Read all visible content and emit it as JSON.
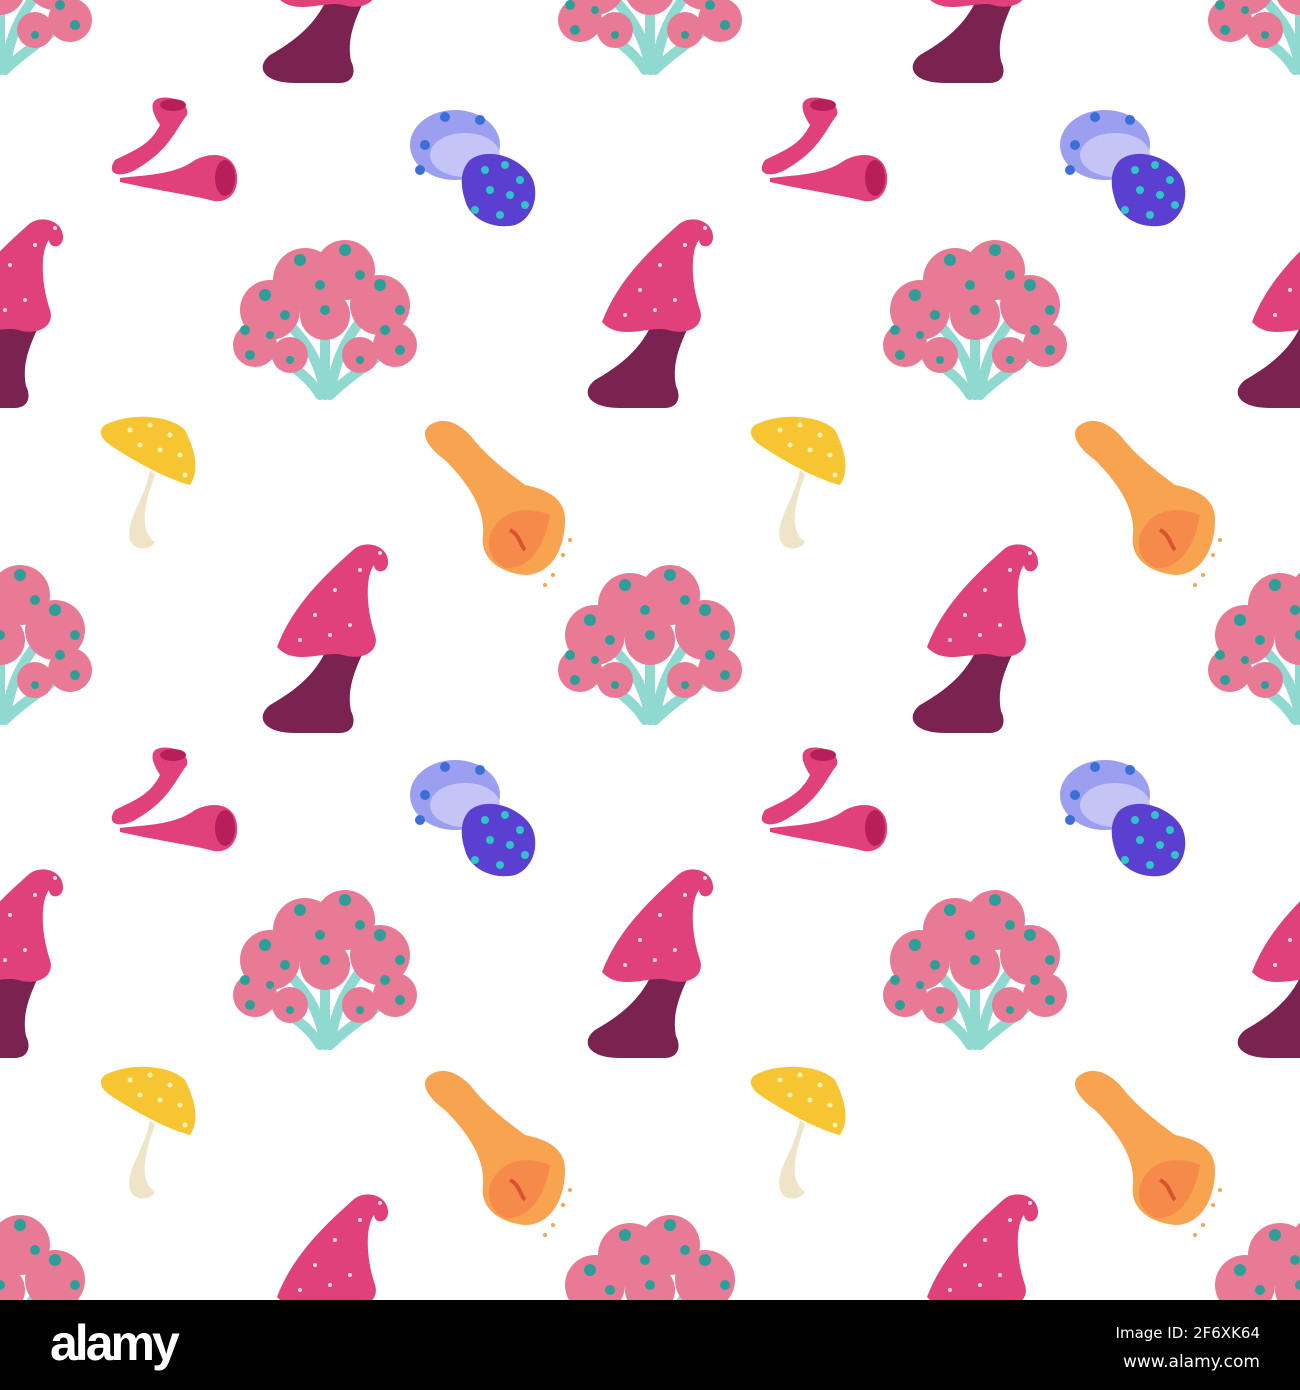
{
  "footer": {
    "brand": "alamy",
    "image_id": "Image ID: 2F6XK64",
    "url": "www.alamy.com"
  },
  "colors": {
    "background": "#ffffff",
    "footer": "#000000",
    "pink": "#e0417a",
    "plum": "#7a2350",
    "cluster_cap": "#e87a96",
    "teal": "#2e9e98",
    "blue": "#5a3fd0",
    "lavender": "#9c9ff0",
    "yellow": "#f7c532",
    "orange": "#f7a350"
  }
}
